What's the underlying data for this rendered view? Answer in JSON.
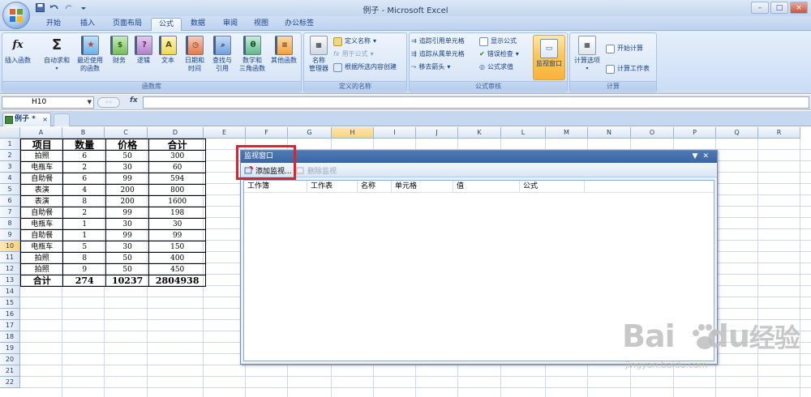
{
  "window": {
    "title": "例子 - Microsoft Excel"
  },
  "colors": {
    "accent": "#15428b",
    "ribbon_bg": "#dbe7f7",
    "highlight_box": "#e3212b",
    "watch_title_bg": "#3a66a3"
  },
  "quick_access": {
    "items": [
      "save-icon",
      "undo-icon",
      "redo-icon",
      "customize-icon"
    ]
  },
  "tabs": {
    "home": "开始",
    "insert": "插入",
    "page_layout": "页面布局",
    "formulas": "公式",
    "data": "数据",
    "review": "审阅",
    "view": "视图",
    "office_tab": "办公标签",
    "active": "公式"
  },
  "ribbon": {
    "insert_function": "插入函数",
    "autosum": "自动求和",
    "recent_line1": "最近使用",
    "recent_line2": "的函数",
    "financial": "财务",
    "logical": "逻辑",
    "text": "文本",
    "datetime_line1": "日期和",
    "datetime_line2": "时间",
    "lookup_line1": "查找与",
    "lookup_line2": "引用",
    "math_line1": "数学和",
    "math_line2": "三角函数",
    "more_functions": "其他函数",
    "function_library": "函数库",
    "name_manager_line1": "名称",
    "name_manager_line2": "管理器",
    "define_name": "定义名称",
    "use_in_formula": "用于公式",
    "create_from_selection": "根据所选内容创建",
    "defined_names": "定义的名称",
    "trace_precedents": "追踪引用单元格",
    "trace_dependents": "追踪从属单元格",
    "remove_arrows": "移去箭头",
    "show_formulas": "显示公式",
    "error_checking": "错误检查",
    "evaluate_formula": "公式求值",
    "watch_window": "监视窗口",
    "formula_auditing": "公式审核",
    "calc_options": "计算选项",
    "calculate_now": "开始计算",
    "calculate_sheet": "计算工作表",
    "calculation": "计算"
  },
  "formula_bar": {
    "name_box": "H10",
    "fx": "fx",
    "content": ""
  },
  "workbook_tab": {
    "label": "例子 *",
    "close": "×"
  },
  "sheet": {
    "columns": [
      "A",
      "B",
      "C",
      "D",
      "E",
      "F",
      "G",
      "H",
      "I",
      "J",
      "K",
      "L",
      "M",
      "N",
      "O",
      "P",
      "Q",
      "R"
    ],
    "selected_column": "H",
    "rows": [
      "1",
      "2",
      "3",
      "4",
      "5",
      "6",
      "7",
      "8",
      "9",
      "10",
      "11",
      "12",
      "13",
      "14",
      "15",
      "16",
      "17",
      "18",
      "19",
      "20",
      "21",
      "22"
    ],
    "selected_row": "10",
    "header": [
      "项目",
      "数量",
      "价格",
      "合计"
    ],
    "data": [
      [
        "拍照",
        "6",
        "50",
        "300"
      ],
      [
        "电瓶车",
        "2",
        "30",
        "60"
      ],
      [
        "自助餐",
        "6",
        "99",
        "594"
      ],
      [
        "表演",
        "4",
        "200",
        "800"
      ],
      [
        "表演",
        "8",
        "200",
        "1600"
      ],
      [
        "自助餐",
        "2",
        "99",
        "198"
      ],
      [
        "电瓶车",
        "1",
        "30",
        "30"
      ],
      [
        "自助餐",
        "1",
        "99",
        "99"
      ],
      [
        "电瓶车",
        "5",
        "30",
        "150"
      ],
      [
        "拍照",
        "8",
        "50",
        "400"
      ],
      [
        "拍照",
        "9",
        "50",
        "450"
      ]
    ],
    "total": [
      "合计",
      "274",
      "10237",
      "2804938"
    ]
  },
  "watch_window": {
    "title": "监视窗口",
    "add_watch": "添加监视...",
    "delete_watch": "删除监视",
    "columns": [
      "工作簿",
      "工作表",
      "名称",
      "单元格",
      "值",
      "公式"
    ]
  },
  "watermark": {
    "brand_left": "Bai",
    "brand_right": "du",
    "brand_cn": "经验",
    "url": "jingyan.baidu.com"
  }
}
